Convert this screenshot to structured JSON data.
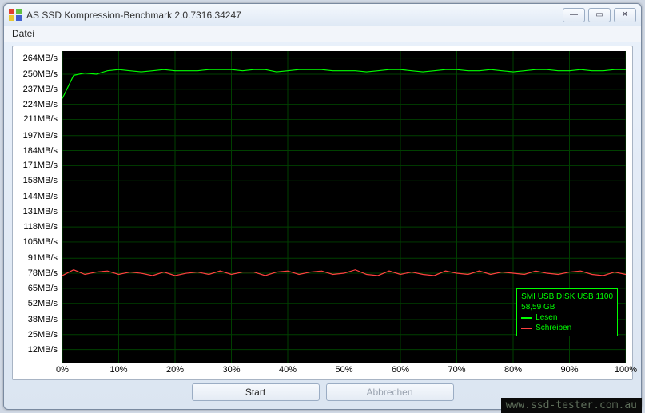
{
  "window": {
    "title": "AS SSD Kompression-Benchmark 2.0.7316.34247",
    "minimize": "—",
    "maximize": "▭",
    "close": "✕"
  },
  "menu": {
    "file": "Datei"
  },
  "buttons": {
    "start": "Start",
    "cancel": "Abbrechen"
  },
  "legend": {
    "device": "SMI USB DISK USB 1100",
    "capacity": "58,59 GB",
    "read_label": "Lesen",
    "write_label": "Schreiben",
    "read_color": "#00ff00",
    "write_color": "#ff4040"
  },
  "watermark": "www.ssd-tester.com.au",
  "chart_data": {
    "type": "line",
    "xlabel": "",
    "ylabel": "",
    "x_tick_labels": [
      "0%",
      "10%",
      "20%",
      "30%",
      "40%",
      "50%",
      "60%",
      "70%",
      "80%",
      "90%",
      "100%"
    ],
    "y_tick_labels": [
      "12MB/s",
      "25MB/s",
      "38MB/s",
      "52MB/s",
      "65MB/s",
      "78MB/s",
      "91MB/s",
      "105MB/s",
      "118MB/s",
      "131MB/s",
      "144MB/s",
      "158MB/s",
      "171MB/s",
      "184MB/s",
      "197MB/s",
      "211MB/s",
      "224MB/s",
      "237MB/s",
      "250MB/s",
      "264MB/s"
    ],
    "ylim": [
      0,
      270
    ],
    "xlim": [
      0,
      100
    ],
    "x": [
      0,
      2,
      4,
      6,
      8,
      10,
      12,
      14,
      16,
      18,
      20,
      22,
      24,
      26,
      28,
      30,
      32,
      34,
      36,
      38,
      40,
      42,
      44,
      46,
      48,
      50,
      52,
      54,
      56,
      58,
      60,
      62,
      64,
      66,
      68,
      70,
      72,
      74,
      76,
      78,
      80,
      82,
      84,
      86,
      88,
      90,
      92,
      94,
      96,
      98,
      100
    ],
    "series": [
      {
        "name": "Lesen",
        "color": "#00ff00",
        "values": [
          229,
          249,
          251,
          250,
          253,
          254,
          253,
          252,
          253,
          254,
          253,
          253,
          253,
          254,
          254,
          254,
          253,
          254,
          254,
          252,
          253,
          254,
          254,
          254,
          253,
          253,
          253,
          252,
          253,
          254,
          254,
          253,
          252,
          253,
          254,
          254,
          253,
          253,
          254,
          253,
          252,
          253,
          254,
          254,
          253,
          253,
          254,
          253,
          253,
          254,
          254
        ]
      },
      {
        "name": "Schreiben",
        "color": "#ff4040",
        "values": [
          76,
          81,
          77,
          79,
          80,
          77,
          79,
          78,
          76,
          79,
          76,
          78,
          79,
          77,
          80,
          77,
          79,
          79,
          76,
          79,
          80,
          77,
          79,
          80,
          77,
          78,
          81,
          77,
          76,
          80,
          77,
          79,
          77,
          76,
          80,
          78,
          77,
          80,
          77,
          79,
          78,
          77,
          80,
          78,
          77,
          79,
          80,
          77,
          76,
          79,
          77
        ]
      }
    ]
  }
}
